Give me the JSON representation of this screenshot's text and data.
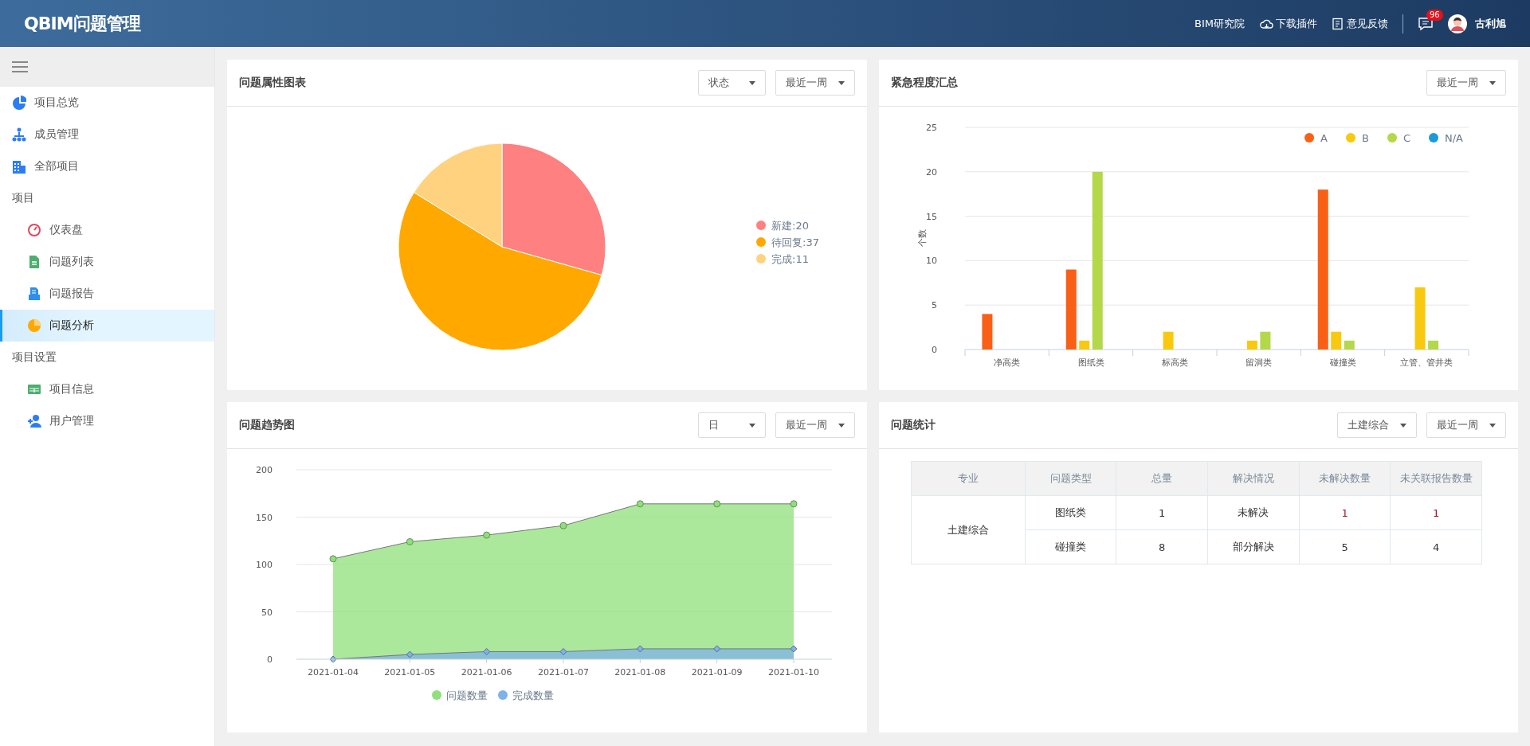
{
  "header": {
    "logo": "QBIM问题管理",
    "links": [
      {
        "label": "BIM研究院",
        "kind": "text"
      },
      {
        "label": "下载插件",
        "kind": "cloud"
      },
      {
        "label": "意见反馈",
        "kind": "doc"
      }
    ],
    "messages_badge": "96",
    "user": "古利旭"
  },
  "sidebar": {
    "items": [
      {
        "label": "项目总览",
        "selected": false
      },
      {
        "label": "成员管理",
        "selected": false
      },
      {
        "label": "全部项目",
        "selected": false
      }
    ],
    "groups": [
      {
        "label": "项目",
        "children": [
          {
            "label": "仪表盘",
            "selected": false
          },
          {
            "label": "问题列表",
            "selected": false
          },
          {
            "label": "问题报告",
            "selected": false
          },
          {
            "label": "问题分析",
            "selected": true
          }
        ]
      },
      {
        "label": "项目设置",
        "children": [
          {
            "label": "项目信息",
            "selected": false
          },
          {
            "label": "用户管理",
            "selected": false
          }
        ]
      }
    ]
  },
  "cards": [
    {
      "title": "问题属性图表",
      "filters": [
        "状态",
        "最近一周"
      ],
      "chart_data": {
        "type": "pie",
        "categories": [
          "新建:20",
          "待回复:37",
          "完成:11"
        ],
        "values": [
          20,
          37,
          11
        ],
        "colors": [
          "#ff8080",
          "#ffa800",
          "#ffd280"
        ],
        "legend": true
      }
    },
    {
      "title": "紧急程度汇总",
      "filters": [
        "最近一周"
      ],
      "chart_data": {
        "type": "bar",
        "ylabel": "个数",
        "grid": true,
        "legend": true,
        "categories": [
          "净高类",
          "图纸类",
          "标高类",
          "留洞类",
          "碰撞类",
          "立管、管井类"
        ],
        "ylim": [
          0,
          25
        ],
        "yticks": [
          0,
          5,
          10,
          15,
          20,
          25
        ],
        "series": [
          {
            "name": "A",
            "color": "#fa5f16",
            "values": [
              4,
              9,
              0,
              0,
              18,
              0
            ]
          },
          {
            "name": "B",
            "color": "#f8c90f",
            "values": [
              0,
              1,
              2,
              1,
              2,
              7
            ]
          },
          {
            "name": "C",
            "color": "#b3d84a",
            "values": [
              0,
              20,
              0,
              2,
              1,
              1
            ]
          },
          {
            "name": "N/A",
            "color": "#1c9ad6",
            "values": [
              0,
              0,
              0,
              0,
              0,
              0
            ]
          }
        ]
      }
    },
    {
      "title": "问题趋势图",
      "filters": [
        "日",
        "最近一周"
      ],
      "chart_data": {
        "type": "area",
        "categories": [
          "2021-01-04",
          "2021-01-05",
          "2021-01-06",
          "2021-01-07",
          "2021-01-08",
          "2021-01-09",
          "2021-01-10"
        ],
        "ylim": [
          0,
          200
        ],
        "yticks": [
          0,
          50,
          100,
          150,
          200
        ],
        "grid": true,
        "legend": true,
        "series": [
          {
            "name": "问题数量",
            "color": "#8fe07a",
            "values": [
              106,
              124,
              131,
              141,
              164,
              164,
              164
            ]
          },
          {
            "name": "完成数量",
            "color": "#7eb3ea",
            "values": [
              0,
              5,
              8,
              8,
              11,
              11,
              11
            ]
          }
        ]
      }
    },
    {
      "title": "问题统计",
      "filters": [
        "土建综合",
        "最近一周"
      ],
      "table": {
        "columns": [
          "专业",
          "问题类型",
          "总量",
          "解决情况",
          "未解决数量",
          "未关联报告数量"
        ],
        "rows": [
          [
            {
              "text": "土建综合",
              "rowspan": 2
            },
            {
              "text": "图纸类"
            },
            {
              "text": "1"
            },
            {
              "text": "未解决"
            },
            {
              "text": "1",
              "alert": true
            },
            {
              "text": "1",
              "alert": true
            }
          ],
          [
            {
              "text": "碰撞类"
            },
            {
              "text": "8"
            },
            {
              "text": "部分解决"
            },
            {
              "text": "5"
            },
            {
              "text": "4"
            }
          ]
        ]
      }
    }
  ]
}
